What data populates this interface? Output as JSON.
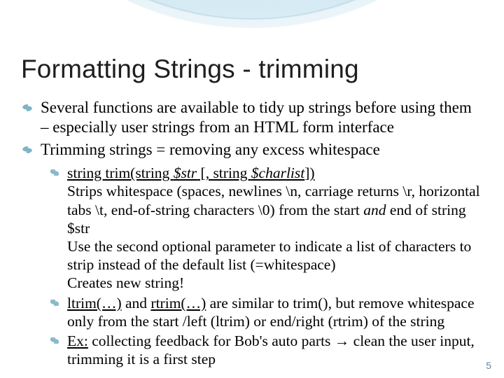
{
  "title": "Formatting Strings - trimming",
  "bullets": {
    "b1a": "Several functions are available to tidy up strings before using them",
    "b1b": "– especially user strings from an HTML form interface",
    "b2": "Trimming strings = removing any excess whitespace",
    "s1_fn": "string trim(string ",
    "s1_a1": "$str",
    "s1_mid": " [, string ",
    "s1_a2": "$charlist",
    "s1_end": "])",
    "s1_d1a": "Strips whitespace (spaces, newlines \\n, carriage returns \\r, horizontal",
    "s1_d1b": "tabs \\t, end-of-string characters \\0) from the start ",
    "s1_and": "and",
    "s1_d1c": " end of string $str",
    "s1_d2a": "Use the second optional parameter to indicate a list of characters to",
    "s1_d2b": "strip instead of the default list (=whitespace)",
    "s1_d3": "Creates new string!",
    "s2_a": "ltrim(…)",
    "s2_mid": " and ",
    "s2_b": "rtrim(…)",
    "s2_c": " are similar to trim(), but remove whitespace",
    "s2_d": "only from the start /left (ltrim) or end/right (rtrim) of the string",
    "s3_a": "Ex:",
    "s3_b": " collecting feedback for Bob's auto parts → clean the user input,",
    "s3_c": "trimming it is a first step"
  },
  "page_number": "5"
}
